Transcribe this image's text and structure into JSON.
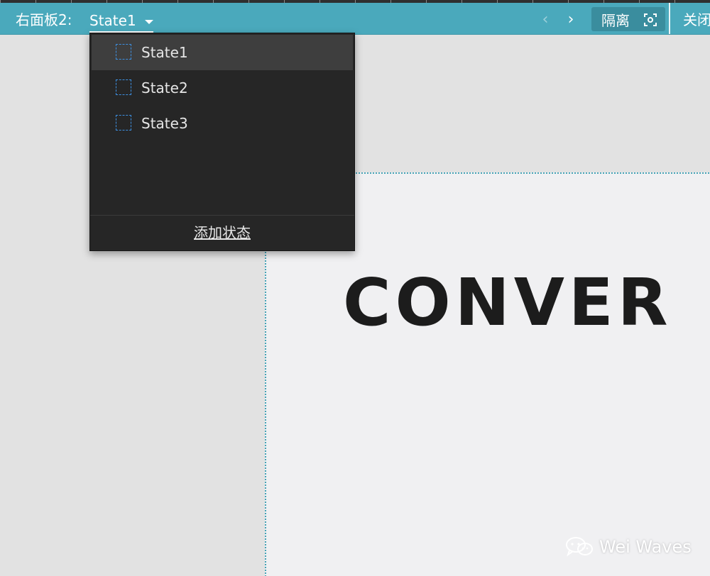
{
  "toolbar": {
    "panel_label": "右面板2:",
    "selected_state": "State1",
    "prev_icon": "chevron-left-icon",
    "next_icon": "chevron-right-icon",
    "isolate_label": "隔离",
    "isolate_icon": "focus-frame-icon",
    "close_label": "关闭"
  },
  "dropdown": {
    "states": [
      {
        "name": "State1",
        "selected": true
      },
      {
        "name": "State2",
        "selected": false
      },
      {
        "name": "State3",
        "selected": false
      }
    ],
    "add_state_label": "添加状态"
  },
  "canvas": {
    "logo_text": "CONVER"
  },
  "watermark": {
    "text": "Wei Waves",
    "icon": "wechat-icon"
  },
  "colors": {
    "toolbar_bg": "#4aa9bc",
    "dropdown_bg": "#262626",
    "state_icon_border": "#3d8fe0",
    "guide_line": "#46a3b6"
  }
}
